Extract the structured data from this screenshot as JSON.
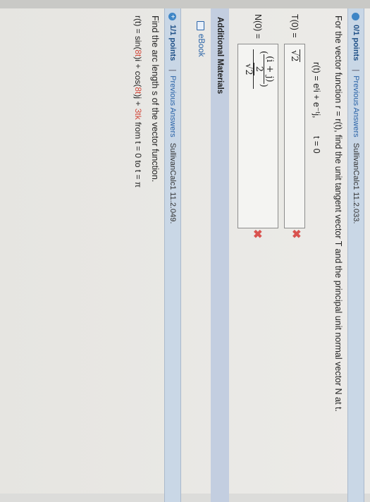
{
  "q1": {
    "points": "0/1 points",
    "separator": "|",
    "previous": "Previous Answers",
    "ref": "SullivanCalc1 11.2.033.",
    "prompt": "For the vector function  r = r(t),  find the unit tangent vector  T  and the principal unit normal vector  N  at t.",
    "equation": "r(t) = eᵗi + e⁻ᵗj,",
    "t_value": "t = 0",
    "T_label": "T(0) =",
    "T_answer": "√2",
    "N_label": "N(0) =",
    "N_answer_num": "(i + j)",
    "N_answer_numden": "2",
    "N_answer_den": "√2",
    "T_status": "✖",
    "N_status": "✖"
  },
  "materials": {
    "heading": "Additional Materials",
    "ebook": "eBook"
  },
  "q2": {
    "icon": "+",
    "points": "1/1 points",
    "separator": "|",
    "previous": "Previous Answers",
    "ref": "SullivanCalc1 11.2.049.",
    "prompt": "Find the arc length  s  of the vector function.",
    "eq_prefix": "r(t) = sin(",
    "eq_8t_1": "8t",
    "eq_mid": ")i + cos(",
    "eq_8t_2": "8t",
    "eq_mid2": ")j + ",
    "eq_3tk": "3tk",
    "eq_from": "  from  t = 0  to  t = π"
  }
}
